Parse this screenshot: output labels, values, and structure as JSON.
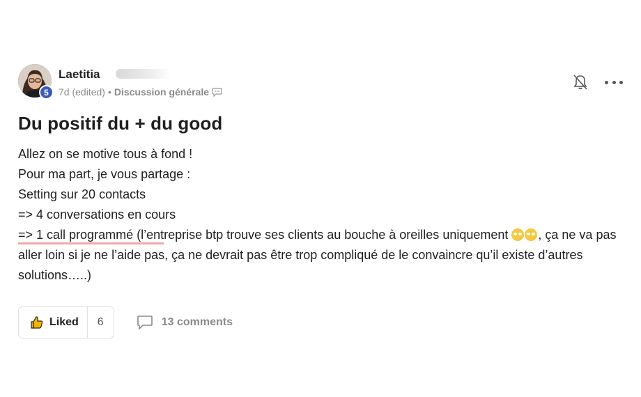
{
  "post": {
    "author": {
      "name": "Laetitia",
      "level": "5"
    },
    "meta": {
      "time": "7d (edited)",
      "separator": "•",
      "category": "Discussion générale"
    },
    "title": "Du positif du + du good",
    "body": {
      "line1": "Allez on se motive tous à fond !",
      "line2": "Pour ma part, je vous partage :",
      "line3": "Setting sur 20 contacts",
      "line4": "=> 4 conversations en cours",
      "line5_underlined": "=> 1 call programmé (l’ent",
      "line5_rest": "reprise btp trouve ses clients au bouche à oreilles uniquement ",
      "line5_after_emoji": ", ça ne va pas aller loin si je ne l’aide pas, ça ne devrait pas être trop compliqué de le convaincre qu’il existe d’autres solutions…..)"
    },
    "actions": {
      "like_label": "Liked",
      "like_count": "6",
      "comments_label": "13 comments"
    }
  },
  "icons": {
    "avatar": "avatar-photo",
    "bell": "bell-off-icon",
    "more": "more-horizontal-icon",
    "chat": "chat-bubble-icon",
    "like": "thumbs-up-icon",
    "comment": "comment-icon"
  },
  "colors": {
    "level_badge": "#3d5bb5",
    "underline": "#f3a8a8",
    "like_icon": "#f5b400"
  }
}
